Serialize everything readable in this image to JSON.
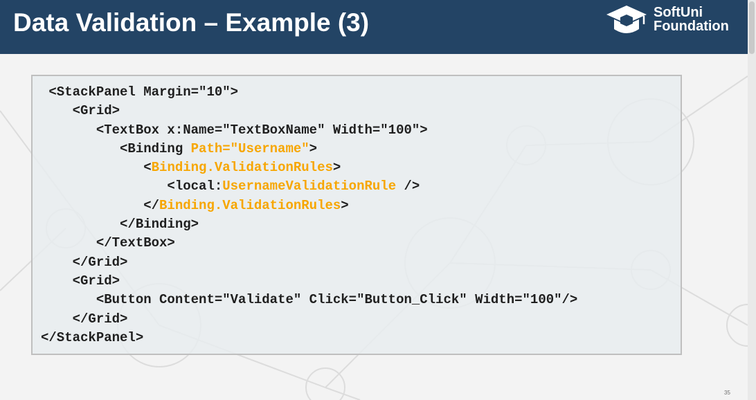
{
  "slide": {
    "title": "Data Validation – Example (3)",
    "page_number": "35"
  },
  "logo": {
    "line1": "SoftUni",
    "line2": "Foundation",
    "icon": "graduation-cap-icon"
  },
  "colors": {
    "header_bg": "#234465",
    "code_highlight": "#f7a600",
    "code_text": "#1f1f1f"
  },
  "code": {
    "lines": [
      [
        {
          "text": " <StackPanel Margin=\"10\">"
        }
      ],
      [
        {
          "text": "    <Grid>"
        }
      ],
      [
        {
          "text": "       <TextBox x:Name=\"TextBoxName\" Width=\"100\">"
        }
      ],
      [
        {
          "text": "          <Binding "
        },
        {
          "text": "Path=\"Username\"",
          "highlight": true
        },
        {
          "text": ">"
        }
      ],
      [
        {
          "text": "             <"
        },
        {
          "text": "Binding.ValidationRules",
          "highlight": true
        },
        {
          "text": ">"
        }
      ],
      [
        {
          "text": "                <local:"
        },
        {
          "text": "UsernameValidationRule",
          "highlight": true
        },
        {
          "text": " />"
        }
      ],
      [
        {
          "text": "             </"
        },
        {
          "text": "Binding.ValidationRules",
          "highlight": true
        },
        {
          "text": ">"
        }
      ],
      [
        {
          "text": "          </Binding>"
        }
      ],
      [
        {
          "text": "       </TextBox>"
        }
      ],
      [
        {
          "text": "    </Grid>"
        }
      ],
      [
        {
          "text": "    <Grid>"
        }
      ],
      [
        {
          "text": "       <Button Content=\"Validate\" Click=\"Button_Click\" Width=\"100\"/>"
        }
      ],
      [
        {
          "text": "    </Grid>"
        }
      ],
      [
        {
          "text": "</StackPanel>"
        }
      ]
    ]
  }
}
